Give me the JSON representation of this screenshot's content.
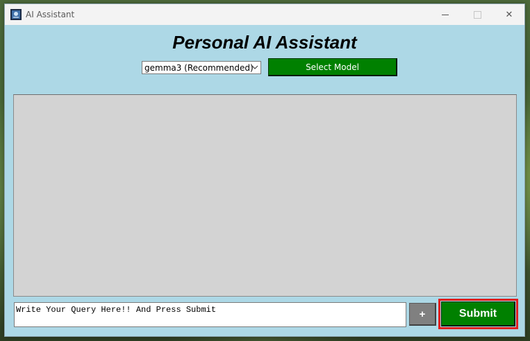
{
  "window": {
    "title": "AI Assistant",
    "controls": {
      "minimize_icon": "minimize-icon",
      "maximize_icon": "maximize-icon",
      "close_glyph": "✕"
    }
  },
  "header": {
    "title": "Personal AI Assistant"
  },
  "model": {
    "selected": "gemma3 (Recommended)",
    "select_button_label": "Select Model"
  },
  "chat": {
    "content": ""
  },
  "query": {
    "value": "Write Your Query Here!! And Press Submit"
  },
  "actions": {
    "plus_label": "+",
    "submit_label": "Submit"
  },
  "colors": {
    "window_bg": "#add8e6",
    "chat_bg": "#d3d3d3",
    "button_green": "#008000",
    "plus_gray": "#808080",
    "highlight_red": "#e02020"
  }
}
